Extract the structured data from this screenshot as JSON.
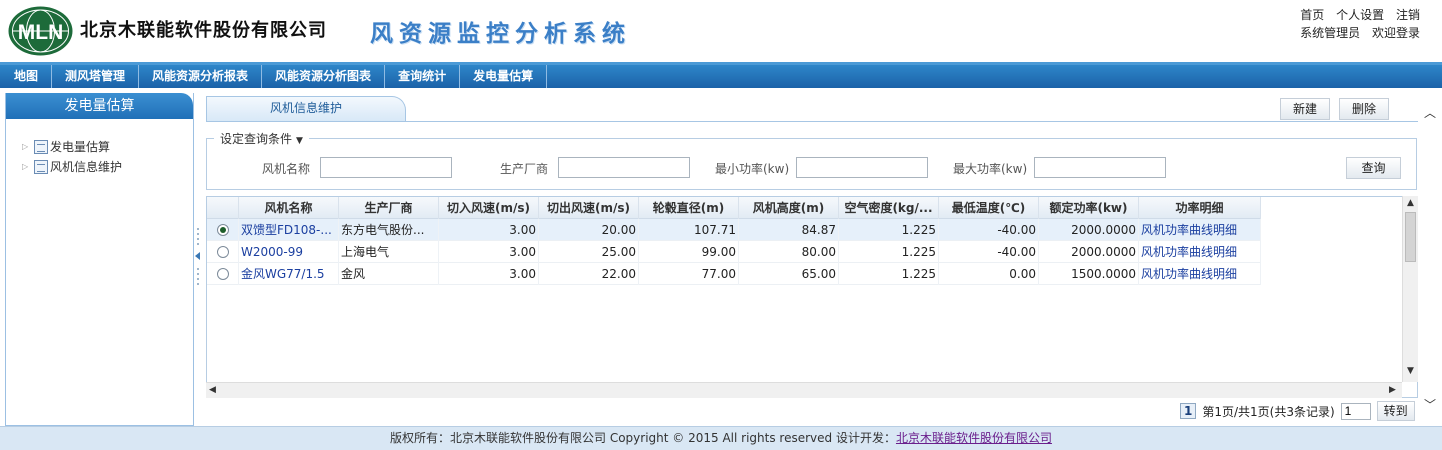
{
  "header": {
    "logo_text": "MLN",
    "company": "北京木联能软件股份有限公司",
    "system_title": "风资源监控分析系统",
    "links": [
      "首页",
      "个人设置",
      "注销"
    ],
    "user_role": "系统管理员",
    "welcome": "欢迎登录"
  },
  "nav": [
    "地图",
    "测风塔管理",
    "风能资源分析报表",
    "风能资源分析图表",
    "查询统计",
    "发电量估算"
  ],
  "sidebar": {
    "title": "发电量估算",
    "items": [
      {
        "label": "发电量估算"
      },
      {
        "label": "风机信息维护"
      }
    ]
  },
  "main": {
    "tab": "风机信息维护",
    "new_button": "新建",
    "delete_button": "删除",
    "query": {
      "legend": "设定查询条件",
      "fields": [
        {
          "label": "风机名称",
          "value": ""
        },
        {
          "label": "生产厂商",
          "value": ""
        },
        {
          "label": "最小功率(kw)",
          "value": ""
        },
        {
          "label": "最大功率(kw)",
          "value": ""
        }
      ],
      "search_button": "查询"
    },
    "table": {
      "columns": [
        "风机名称",
        "生产厂商",
        "切入风速(m/s)",
        "切出风速(m/s)",
        "轮毂直径(m)",
        "风机高度(m)",
        "空气密度(kg/...",
        "最低温度(℃)",
        "额定功率(kw)",
        "功率明细"
      ],
      "rows": [
        {
          "selected": true,
          "name": "双馈型FD108-...",
          "maker": "东方电气股份...",
          "cut_in": "3.00",
          "cut_out": "20.00",
          "diameter": "107.71",
          "height": "84.87",
          "density": "1.225",
          "min_temp": "-40.00",
          "rated_power": "2000.0000",
          "detail": "风机功率曲线明细"
        },
        {
          "selected": false,
          "name": "W2000-99",
          "maker": "上海电气",
          "cut_in": "3.00",
          "cut_out": "25.00",
          "diameter": "99.00",
          "height": "80.00",
          "density": "1.225",
          "min_temp": "-40.00",
          "rated_power": "2000.0000",
          "detail": "风机功率曲线明细"
        },
        {
          "selected": false,
          "name": "金风WG77/1.5",
          "maker": "金风",
          "cut_in": "3.00",
          "cut_out": "22.00",
          "diameter": "77.00",
          "height": "65.00",
          "density": "1.225",
          "min_temp": "0.00",
          "rated_power": "1500.0000",
          "detail": "风机功率曲线明细"
        }
      ]
    },
    "pager": {
      "current_page": "1",
      "summary": "第1页/共1页(共3条记录)",
      "goto_value": "1",
      "goto_button": "转到"
    }
  },
  "footer": {
    "copyright": "版权所有：北京木联能软件股份有限公司  Copyright © 2015 All rights reserved 设计开发：",
    "developer_link": "北京木联能软件股份有限公司"
  },
  "colors": {
    "nav_blue": "#1b62a8",
    "title_blue": "#3b7fc7",
    "logo_green": "#1d6b3a"
  }
}
